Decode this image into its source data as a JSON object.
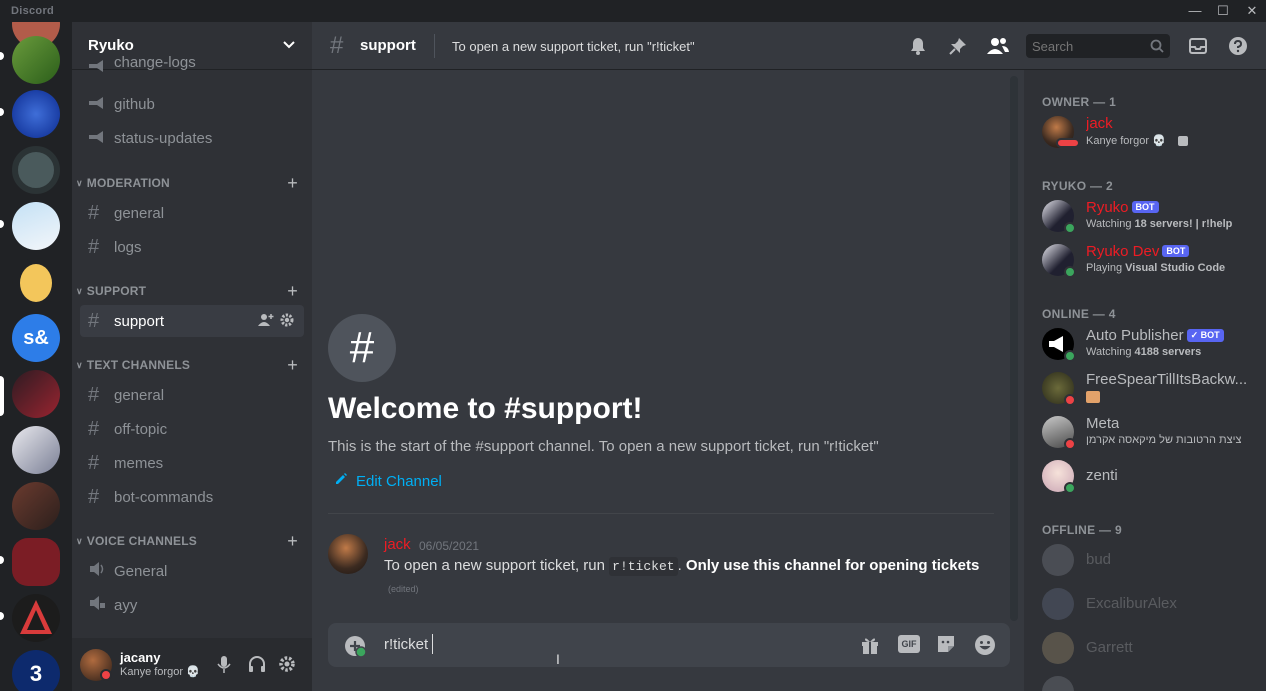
{
  "app_title": "Discord",
  "window_controls": {
    "minimize": "—",
    "maximize": "☐",
    "close": "✕"
  },
  "server": {
    "name": "Ryuko"
  },
  "channels_top": [
    {
      "name": "change-logs"
    },
    {
      "name": "github"
    },
    {
      "name": "status-updates"
    }
  ],
  "categories": {
    "moderation": {
      "label": "MODERATION",
      "channels": [
        "general",
        "logs"
      ]
    },
    "support": {
      "label": "SUPPORT",
      "channels": [
        "support"
      ]
    },
    "text": {
      "label": "TEXT CHANNELS",
      "channels": [
        "general",
        "off-topic",
        "memes",
        "bot-commands"
      ]
    },
    "voice": {
      "label": "VOICE CHANNELS",
      "channels": [
        "General",
        "ayy"
      ]
    }
  },
  "user_panel": {
    "username": "jacany",
    "status": "Kanye forgor 💀"
  },
  "header": {
    "channel": "support",
    "topic": "To open a new support ticket, run \"r!ticket\"",
    "search_placeholder": "Search"
  },
  "welcome": {
    "title": "Welcome to #support!",
    "subtitle": "This is the start of the #support channel. To open a new support ticket, run \"r!ticket\"",
    "edit_label": "Edit Channel"
  },
  "message": {
    "author": "jack",
    "timestamp": "06/05/2021",
    "text_before": "To open a new support ticket, run ",
    "code": "r!ticket",
    "text_after": ". ",
    "bold": "Only use this channel for opening tickets",
    "edited": "(edited)"
  },
  "composer": {
    "value": "r!ticket",
    "gif_label": "GIF"
  },
  "members": {
    "owner": {
      "label": "OWNER — 1",
      "items": [
        {
          "name": "jack",
          "status": "Kanye forgor 💀"
        }
      ]
    },
    "ryuko": {
      "label": "RYUKO — 2",
      "items": [
        {
          "name": "Ryuko",
          "badge": "BOT",
          "status_prefix": "Watching ",
          "status_bold": "18 servers! | r!help"
        },
        {
          "name": "Ryuko Dev",
          "badge": "BOT",
          "status_prefix": "Playing ",
          "status_bold": "Visual Studio Code"
        }
      ]
    },
    "online": {
      "label": "ONLINE — 4",
      "items": [
        {
          "name": "Auto Publisher",
          "badge": "✓ BOT",
          "status_prefix": "Watching ",
          "status_bold": "4188 servers"
        },
        {
          "name": "FreeSpearTillItsBackw..."
        },
        {
          "name": "Meta",
          "status": "ציצת הרטובות של מיקאסה אקרמן"
        },
        {
          "name": "zenti"
        }
      ]
    },
    "offline": {
      "label": "OFFLINE — 9",
      "items": [
        {
          "name": "bud"
        },
        {
          "name": "ExcaliburAlex"
        },
        {
          "name": "Garrett"
        }
      ]
    }
  },
  "colors": {
    "accent": "#5865f2",
    "owner_red": "#ed1c24",
    "link": "#00aff4",
    "online": "#3ba55d",
    "dnd": "#ed4245"
  }
}
